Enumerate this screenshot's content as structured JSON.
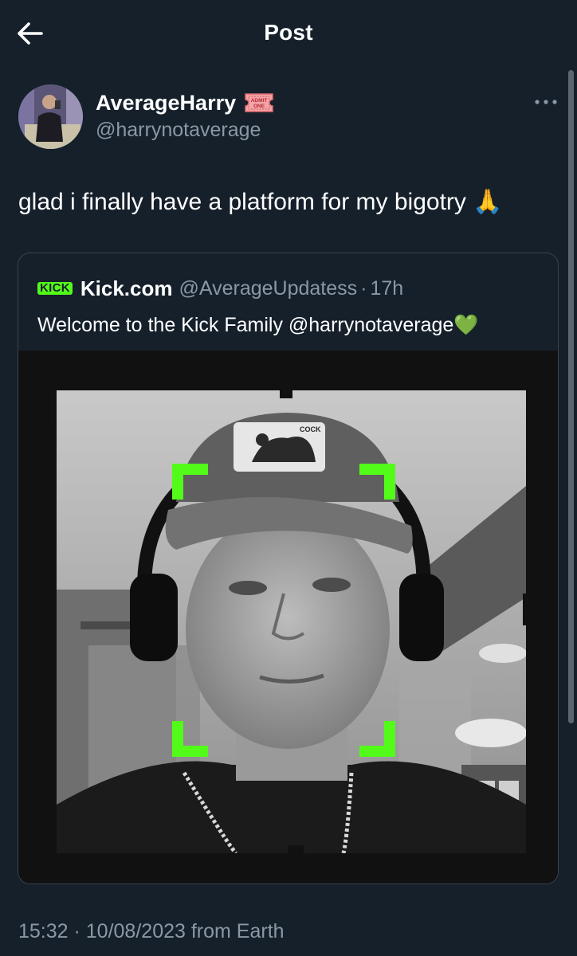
{
  "header": {
    "title": "Post",
    "back_icon": "arrow-left-icon"
  },
  "author": {
    "name": "AverageHarry",
    "handle": "@harrynotaverage",
    "badge_line1": "ADMIT",
    "badge_line2": "ONE",
    "badge_icon": "admit-one-ticket-icon",
    "more_icon": "more-horizontal-icon"
  },
  "tweet": {
    "text": "glad i finally have a platform for my bigotry",
    "emoji": "🙏"
  },
  "quote": {
    "logo_text": "KICK",
    "name": "Kick.com",
    "handle": "@AverageUpdatess",
    "dot": "·",
    "time": "17h",
    "text": "Welcome to the Kick Family @harrynotaverage",
    "emoji": "💚",
    "cap_text": "COCK"
  },
  "timestamp": "15:32 · 10/08/2023 from Earth",
  "colors": {
    "background": "#15202b",
    "secondary_text": "#8b98a5",
    "border": "#38444d",
    "kick_green": "#53fc18"
  }
}
